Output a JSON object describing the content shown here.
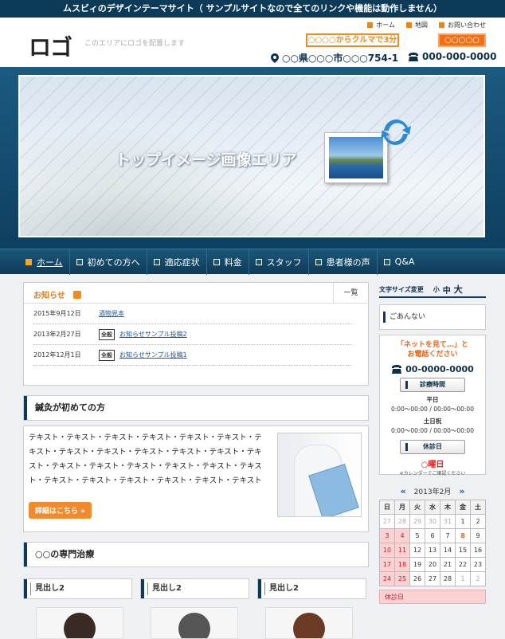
{
  "topbar": {
    "text": "ムスビィのデザインテーマサイト（ サンプルサイトなので全てのリンクや機能は動作しません）"
  },
  "header": {
    "logo": "ロゴ",
    "logo_note": "このエリアにロゴを配置します",
    "nav": [
      "ホーム",
      "地図",
      "お問い合わせ"
    ],
    "badge_car": "○○○○からクルマで3分",
    "badge_right": "○○○○○",
    "address": "○○県○○○市○○○754-1",
    "tel": "000-000-0000"
  },
  "hero": {
    "text": "トップイメージ画像エリア"
  },
  "mainnav": [
    "ホーム",
    "初めての方へ",
    "適応症状",
    "料金",
    "スタッフ",
    "患者様の声",
    "Q&A"
  ],
  "news": {
    "title": "お知らせ",
    "all": "一覧",
    "items": [
      {
        "date": "2015年9月12日",
        "tag": "",
        "title": "酒物見本"
      },
      {
        "date": "2013年2月27日",
        "tag": "全般",
        "title": "お知らせサンプル投稿2"
      },
      {
        "date": "2012年12月1日",
        "tag": "全般",
        "title": "お知らせサンプル投稿1"
      }
    ]
  },
  "intro": {
    "heading": "鍼灸が初めての方",
    "text": "テキスト・テキスト・テキスト・テキスト・テキスト・テキスト・テキスト・テキスト・テキスト・テキスト・テキスト・テキスト・テキスト・テキスト・テキスト・テキスト・テキスト・テキスト・テキスト・テキスト・テキスト・テキスト・テキスト・テキスト・テキスト",
    "button": "詳細はこちら »"
  },
  "specialty": {
    "heading": "○○の専門治療",
    "subs": [
      "見出し2",
      "見出し2",
      "見出し2"
    ]
  },
  "sidebar": {
    "fontsize_label": "文字サイズ変更",
    "fs_small": "小",
    "fs_mid": "中",
    "fs_large": "大",
    "guide": "ごあんない",
    "call_q1": "「ネットを見て…」と",
    "call_q2": "お電話ください",
    "call_tel": "00-0000-0000",
    "hours_btn": "診療時間",
    "weekday": "平日",
    "weekday_time": "0:00～00:00 / 00:00～00:00",
    "weekend": "土日祝",
    "weekend_time": "0:00～00:00 / 00:00～00:00",
    "closed_btn": "休診日",
    "closed_day": "○曜日",
    "cal_note": "※カレンダーでご確認ください",
    "cal_title": "2013年2月",
    "cal_week": [
      "日",
      "月",
      "火",
      "水",
      "木",
      "金",
      "土"
    ],
    "cal_rows": [
      [
        "27",
        "28",
        "29",
        "30",
        "31",
        "1",
        "2"
      ],
      [
        "3",
        "4",
        "5",
        "6",
        "7",
        "8",
        "9"
      ],
      [
        "10",
        "11",
        "12",
        "13",
        "14",
        "15",
        "16"
      ],
      [
        "17",
        "18",
        "19",
        "20",
        "21",
        "22",
        "23"
      ],
      [
        "24",
        "25",
        "26",
        "27",
        "28",
        "1",
        "2"
      ]
    ],
    "closed_label": "休診日"
  }
}
